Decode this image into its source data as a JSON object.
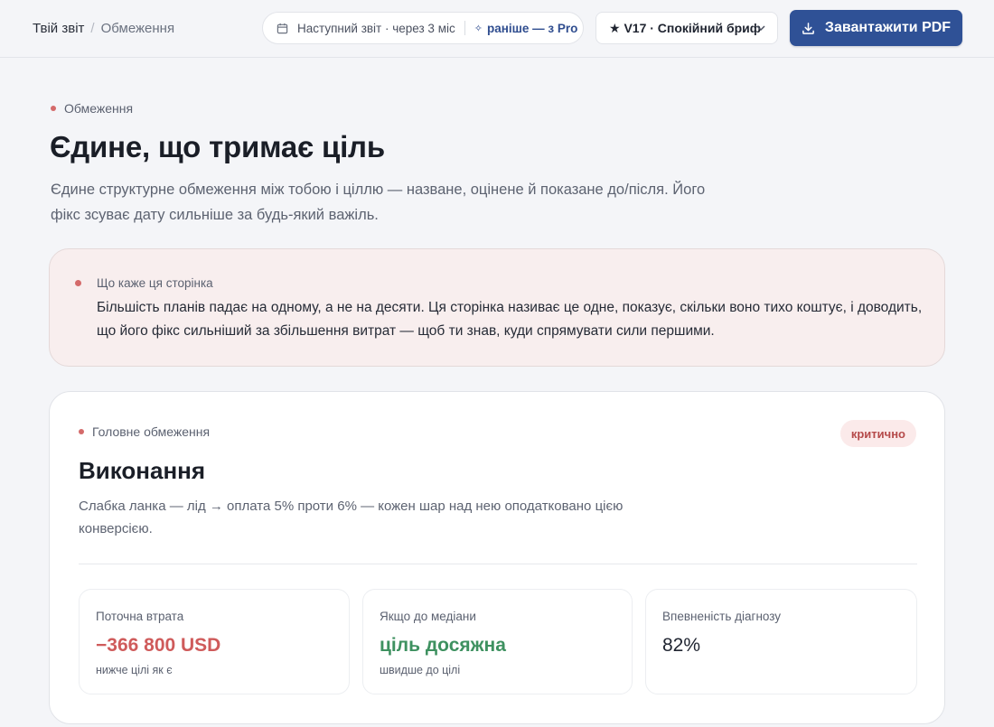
{
  "breadcrumb": {
    "root": "Твій звіт",
    "separator": "/",
    "current": "Обмеження"
  },
  "next_report": {
    "icon": "calendar-icon",
    "text": "Наступний звіт · через 3 міс",
    "pro_icon": "sparkle-icon",
    "pro_text": "раніше — з Pro"
  },
  "version_select": {
    "value": "★ V17 · Спокійний бриф",
    "icon": "chevron-down-icon"
  },
  "download_button": {
    "icon": "download-icon",
    "label": "Завантажити PDF"
  },
  "header": {
    "eyebrow": "Обмеження",
    "title": "Єдине, що тримає ціль",
    "lede": "Єдине структурне обмеження між тобою і ціллю — назване, оцінене й показане до/після. Його фікс зсуває дату сильніше за будь-який важіль."
  },
  "note": {
    "label": "Що каже ця сторінка",
    "body": "Більшість планів падає на одному, а не на десяти. Ця сторінка називає це одне, показує, скільки воно тихо коштує, і доводить, що його фікс сильніший за збільшення витрат — щоб ти знав, куди спрямувати сили першими."
  },
  "constraint": {
    "eyebrow": "Головне обмеження",
    "badge": "критично",
    "title": "Виконання",
    "description": "Слабка ланка — лід → оплата 5% проти 6% — кожен шар над нею оподатковано цією конверсією.",
    "metrics": [
      {
        "label": "Поточна втрата",
        "value": "−366 800 USD",
        "sub": "нижче цілі як є"
      },
      {
        "label": "Якщо до медіани",
        "value": "ціль досяжна",
        "sub": "швидше до цілі"
      },
      {
        "label": "Впевненість діагнозу",
        "value": "82%",
        "sub": ""
      }
    ]
  },
  "colors": {
    "accent": "#2f5196",
    "danger": "#cf5b5b",
    "success": "#3e9160",
    "note_bg": "#f8eeee",
    "badge_bg": "#fbeaea"
  }
}
